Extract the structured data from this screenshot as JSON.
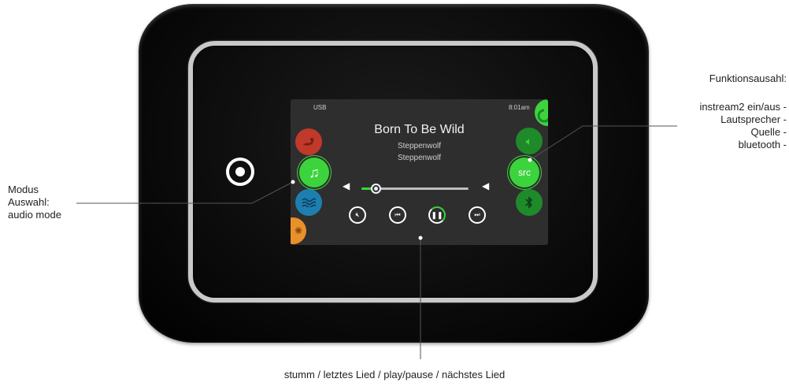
{
  "screen": {
    "source_label": "USB",
    "time": "8:01am",
    "song_title": "Born To Be Wild",
    "artist_line_1": "Steppenwolf",
    "artist_line_2": "Steppenwolf",
    "volume_level_fraction": 0.13
  },
  "right_buttons": {
    "source_label": "src"
  },
  "annotations": {
    "left": [
      "Modus",
      "Auswahl:",
      "audio mode"
    ],
    "right_title": "Funktionsausahl:",
    "right_items": [
      "instream2 ein/aus -",
      "Lautsprecher -",
      "Quelle -",
      "bluetooth -"
    ],
    "bottom": "stumm / letztes Lied / play/pause / nächstes Lied"
  },
  "colors": {
    "active_green": "#3cd43c",
    "dark_green": "#1f8a2a",
    "spa_red": "#c0392b",
    "water_blue": "#1d7fb0",
    "light_orange": "#e8902a"
  }
}
